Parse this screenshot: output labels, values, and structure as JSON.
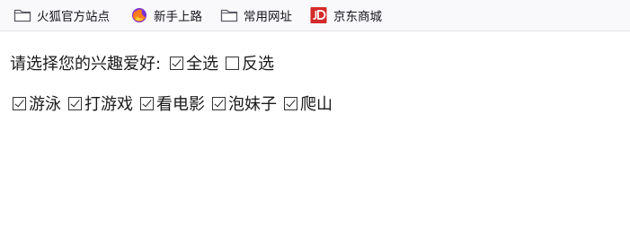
{
  "bookmarks": [
    {
      "label": "火狐官方站点",
      "icon": "folder-icon"
    },
    {
      "label": "新手上路",
      "icon": "firefox-icon"
    },
    {
      "label": "常用网址",
      "icon": "folder-icon"
    },
    {
      "label": "京东商城",
      "icon": "jd-icon"
    }
  ],
  "form": {
    "prompt": "请选择您的兴趣爱好:",
    "select_all": {
      "label": "全选",
      "checked": true
    },
    "invert": {
      "label": "反选",
      "checked": false
    },
    "hobbies": [
      {
        "label": "游泳",
        "checked": true
      },
      {
        "label": "打游戏",
        "checked": true
      },
      {
        "label": "看电影",
        "checked": true
      },
      {
        "label": "泡妹子",
        "checked": true
      },
      {
        "label": "爬山",
        "checked": true
      }
    ]
  },
  "colors": {
    "toolbar_bg": "#f9f9fb",
    "jd_red": "#d42a2a",
    "folder": "#5b5b66"
  }
}
